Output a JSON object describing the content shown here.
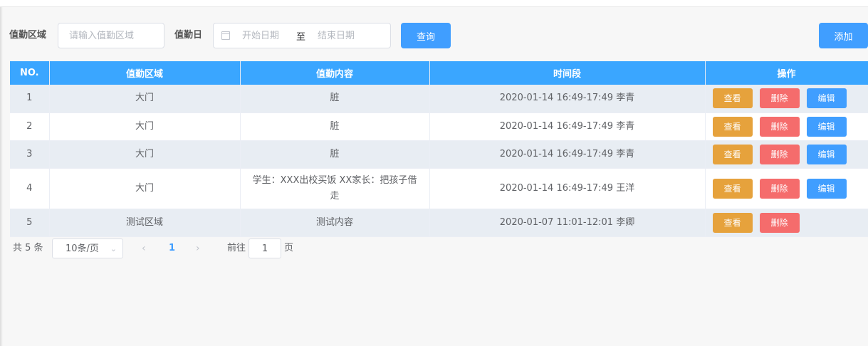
{
  "filters": {
    "area_label": "值勤区域",
    "area_placeholder": "请输入值勤区域",
    "date_label": "值勤日",
    "start_placeholder": "开始日期",
    "range_separator": "至",
    "end_placeholder": "结束日期",
    "query_button": "查询",
    "add_button": "添加"
  },
  "table": {
    "columns": [
      "NO.",
      "值勤区域",
      "值勤内容",
      "时间段",
      "操作"
    ],
    "rows": [
      {
        "no": "1",
        "area": "大门",
        "content": "脏",
        "time": "2020-01-14 16:49-17:49 李青",
        "actions": [
          "查看",
          "删除",
          "编辑"
        ]
      },
      {
        "no": "2",
        "area": "大门",
        "content": "脏",
        "time": "2020-01-14 16:49-17:49 李青",
        "actions": [
          "查看",
          "删除",
          "编辑"
        ]
      },
      {
        "no": "3",
        "area": "大门",
        "content": "脏",
        "time": "2020-01-14 16:49-17:49 李青",
        "actions": [
          "查看",
          "删除",
          "编辑"
        ]
      },
      {
        "no": "4",
        "area": "大门",
        "content": "学生：XXX出校买饭 XX家长：把孩子借走",
        "time": "2020-01-14 16:49-17:49 王洋",
        "actions": [
          "查看",
          "删除",
          "编辑"
        ]
      },
      {
        "no": "5",
        "area": "测试区域",
        "content": "测试内容",
        "time": "2020-01-07 11:01-12:01 李卿",
        "actions": [
          "查看",
          "删除"
        ]
      }
    ]
  },
  "pagination": {
    "total_text": "共 5 条",
    "page_size": "10条/页",
    "current_page": "1",
    "goto_label": "前往",
    "goto_value": "1",
    "page_suffix": "页"
  },
  "icons": {
    "calendar": "calendar-icon",
    "prev": "chevron-left-icon",
    "next": "chevron-right-icon",
    "dropdown": "chevron-down-icon"
  },
  "colors": {
    "primary": "#409eff",
    "header": "#3aa6ff",
    "view": "#e6a23c",
    "delete": "#f56c6c"
  }
}
